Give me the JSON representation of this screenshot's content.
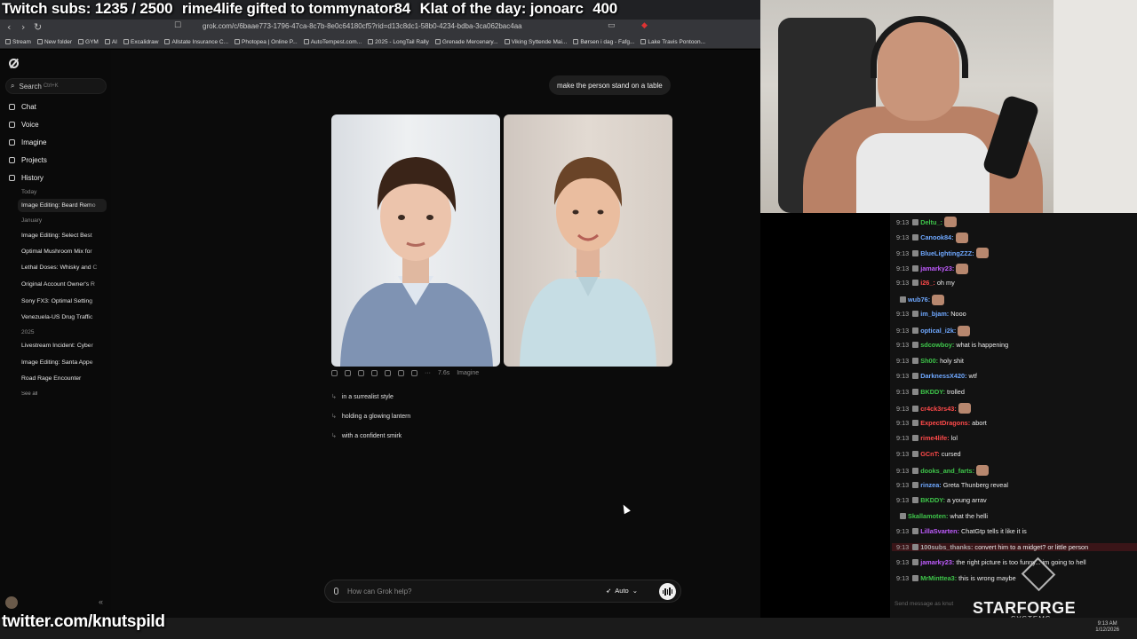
{
  "overlay": {
    "subs": "Twitch subs: 1235 / 2500",
    "gifted": "rime4life gifted to tommynator84",
    "klat": "Klat of the day: jonoarc",
    "klat_count": "400",
    "twitter": "twitter.com/knutspild"
  },
  "browser": {
    "url": "grok.com/c/6baae773-1796-47ca-8c7b-8e0c64180cf5?rid=d13c8dc1-58b0-4234-bdba-3ca062bac4aa",
    "bookmarks": [
      "Stream",
      "New folder",
      "GYM",
      "AI",
      "Excalidraw",
      "Allstate Insurance C...",
      "Photopea | Online P...",
      "AutoTempest.com...",
      "2025 - LongTail Rally",
      "Grenade Mercenary...",
      "Viking Syttende Mai...",
      "Børsen i dag - Fafg...",
      "Lake Travis Pontoon..."
    ]
  },
  "sidebar": {
    "search_label": "Search",
    "search_shortcut": "Ctrl+K",
    "nav": {
      "chat": "Chat",
      "voice": "Voice",
      "imagine": "Imagine",
      "projects": "Projects",
      "history": "History"
    },
    "today_label": "Today",
    "today_items": [
      "Image Editing: Beard Remo"
    ],
    "january_label": "January",
    "january_items": [
      "Image Editing: Select Best",
      "Optimal Mushroom Mix for",
      "Lethal Doses: Whisky and C",
      "Original Account Owner's R",
      "Sony FX3: Optimal Setting",
      "Venezuela-US Drug Traffic"
    ],
    "year_label": "2025",
    "year_items": [
      "Livestream Incident: Cyber",
      "Image Editing: Santa Appe",
      "Road Rage Encounter"
    ],
    "see_all": "See all"
  },
  "chat": {
    "user_message": "make the person stand on a table",
    "response_time": "7.6s",
    "response_source": "Imagine",
    "suggestions": [
      "in a surrealist style",
      "holding a glowing lantern",
      "with a confident smirk"
    ],
    "composer_placeholder": "How can Grok help?",
    "mode": "Auto"
  },
  "twitch_chat": [
    {
      "time": "9:13",
      "user": "Deltu_:",
      "color": "#3ec44a",
      "msg": ""
    },
    {
      "time": "9:13",
      "user": "Canook84:",
      "color": "#6fa8ff",
      "msg": ""
    },
    {
      "time": "9:13",
      "user": "BlueLightingZZZ:",
      "color": "#6fa8ff",
      "msg": ""
    },
    {
      "time": "9:13",
      "user": "jamarky23:",
      "color": "#c05cff",
      "msg": ""
    },
    {
      "time": "9:13",
      "user": "i26_:",
      "color": "#ff4a4a",
      "msg": "oh my"
    },
    {
      "time": "",
      "user": "wub76:",
      "color": "#6fa8ff",
      "msg": ""
    },
    {
      "time": "9:13",
      "user": "im_bjam:",
      "color": "#6fa8ff",
      "msg": "Nooo"
    },
    {
      "time": "9:13",
      "user": "optical_i2k:",
      "color": "#6fa8ff",
      "msg": ""
    },
    {
      "time": "9:13",
      "user": "sdcowboy:",
      "color": "#3ec44a",
      "msg": "what is happening"
    },
    {
      "time": "9:13",
      "user": "Sh00:",
      "color": "#3ec44a",
      "msg": "holy shit"
    },
    {
      "time": "9:13",
      "user": "DarknessX420:",
      "color": "#6fa8ff",
      "msg": "wtf"
    },
    {
      "time": "9:13",
      "user": "BKDDY:",
      "color": "#3ec44a",
      "msg": "trolled"
    },
    {
      "time": "9:13",
      "user": "cr4ck3rs43:",
      "color": "#ff4a4a",
      "msg": ""
    },
    {
      "time": "9:13",
      "user": "ExpectDragons:",
      "color": "#ff4a4a",
      "msg": "abort"
    },
    {
      "time": "9:13",
      "user": "rime4life:",
      "color": "#ff4a4a",
      "msg": "lol"
    },
    {
      "time": "9:13",
      "user": "GCnT:",
      "color": "#ff4a4a",
      "msg": "cursed"
    },
    {
      "time": "9:13",
      "user": "dooks_and_farts:",
      "color": "#3ec44a",
      "msg": ""
    },
    {
      "time": "9:13",
      "user": "rinzea:",
      "color": "#6fa8ff",
      "msg": "Greta Thunberg reveal"
    },
    {
      "time": "9:13",
      "user": "BKDDY:",
      "color": "#3ec44a",
      "msg": "a young arrav"
    },
    {
      "time": "",
      "user": "Skallamoten:",
      "color": "#3ec44a",
      "msg": "what the helli"
    },
    {
      "time": "9:13",
      "user": "LillaSvarten:",
      "color": "#c05cff",
      "msg": "ChatGtp tells it like it is"
    },
    {
      "time": "9:13",
      "user": "100subs_thanks:",
      "color": "#aaaaaa",
      "msg": "convert him to a midget? or little person"
    },
    {
      "time": "9:13",
      "user": "jamarky23:",
      "color": "#c05cff",
      "msg": "the right picture is too funny... im going to hell"
    },
    {
      "time": "9:13",
      "user": "MrMinttea3:",
      "color": "#3ec44a",
      "msg": "this is wrong maybe"
    }
  ],
  "chat_input_hint": "Send message as knut",
  "brand": {
    "name": "STARFORGE",
    "sub": "SYSTEMS"
  },
  "clock": {
    "time": "9:13 AM",
    "date": "1/12/2026"
  }
}
